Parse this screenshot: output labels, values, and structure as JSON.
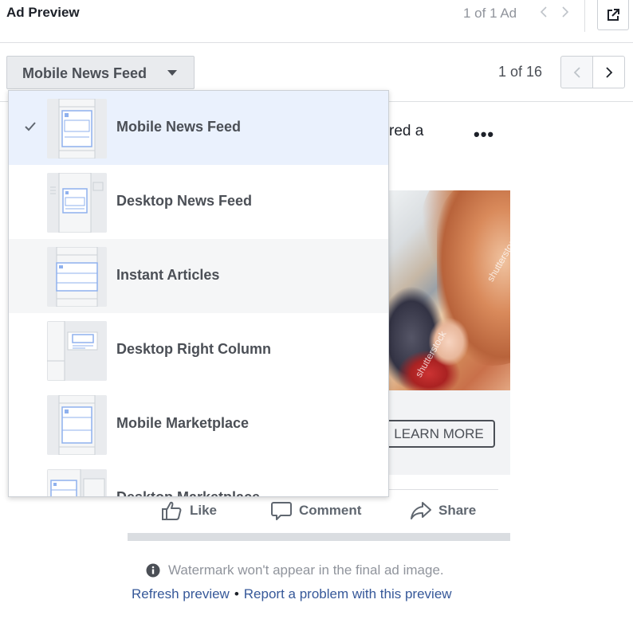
{
  "header": {
    "title": "Ad Preview",
    "ad_count": "1 of 1 Ad",
    "prev_icon": "chevron-left-icon",
    "next_icon": "chevron-right-icon",
    "open_icon": "external-link-icon"
  },
  "toolbar": {
    "placement_selected": "Mobile News Feed",
    "caret_icon": "caret-down-icon",
    "pager_count": "1 of 16"
  },
  "menu": {
    "items": [
      {
        "label": "Mobile News Feed",
        "selected": true,
        "icon": "mobile-news-feed-thumbnail"
      },
      {
        "label": "Desktop News Feed",
        "selected": false,
        "icon": "desktop-news-feed-thumbnail"
      },
      {
        "label": "Instant Articles",
        "selected": false,
        "icon": "instant-articles-thumbnail"
      },
      {
        "label": "Desktop Right Column",
        "selected": false,
        "icon": "desktop-right-column-thumbnail"
      },
      {
        "label": "Mobile Marketplace",
        "selected": false,
        "icon": "mobile-marketplace-thumbnail"
      },
      {
        "label": "Desktop Marketplace",
        "selected": false,
        "icon": "desktop-marketplace-thumbnail"
      }
    ]
  },
  "preview": {
    "post_text_fragment": "red a",
    "more_icon": "more-dots-icon",
    "watermark_text": "shutterstock",
    "cta_label": "LEARN MORE",
    "actions": {
      "like": "Like",
      "comment": "Comment",
      "share": "Share"
    }
  },
  "footer": {
    "note": "Watermark won't appear in the final ad image.",
    "refresh_link": "Refresh preview",
    "separator": "•",
    "report_link": "Report a problem with this preview"
  },
  "colors": {
    "selected_bg": "#eaf1fd",
    "link": "#365899",
    "thumb_accent": "#8fb1ee"
  }
}
